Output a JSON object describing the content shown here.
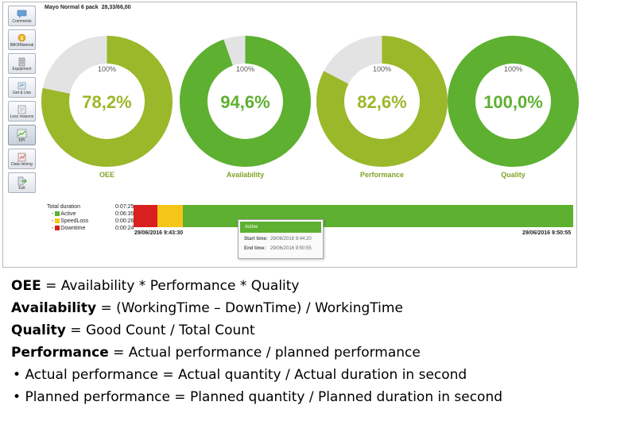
{
  "window": {
    "title": "Mayo Normal 6 pack  28,33/66,00"
  },
  "toolbar": {
    "buttons": [
      {
        "label": "Comments",
        "icon": "comments-icon"
      },
      {
        "label": "BillOfMaterial",
        "icon": "bill-of-material-icon"
      },
      {
        "label": "Equipment",
        "icon": "equipment-icon"
      },
      {
        "label": "Get & Use",
        "icon": "get-and-use-icon"
      },
      {
        "label": "Loss reasons",
        "icon": "loss-reasons-icon"
      },
      {
        "label": "KPI",
        "icon": "kpi-icon",
        "active": true
      },
      {
        "label": "Data mining",
        "icon": "data-mining-icon"
      },
      {
        "label": "Exit",
        "icon": "exit-icon"
      }
    ]
  },
  "kpis": [
    {
      "name": "OEE",
      "value_text": "78,2%",
      "value": 78.2,
      "max_text": "100%",
      "color": "#9ab82a"
    },
    {
      "name": "Availability",
      "value_text": "94,6%",
      "value": 94.6,
      "max_text": "100%",
      "color": "#5eb030"
    },
    {
      "name": "Performance",
      "value_text": "82,6%",
      "value": 82.6,
      "max_text": "100%",
      "color": "#9ab82a"
    },
    {
      "name": "Quality",
      "value_text": "100,0%",
      "value": 100.0,
      "max_text": "100%",
      "color": "#5eb030"
    }
  ],
  "colors": {
    "remainder": "#e3e3e3",
    "label": "#7fa326",
    "active": "#5eb030",
    "speedloss": "#f5c518",
    "downtime": "#d92020"
  },
  "durations": {
    "total": {
      "label": "Total duration",
      "value": "0:07:25"
    },
    "items": [
      {
        "label": "Active",
        "value": "0:06:35",
        "color": "#5eb030"
      },
      {
        "label": "SpeedLoss",
        "value": "0:00:26",
        "color": "#f5c518"
      },
      {
        "label": "Downtime",
        "value": "0:00:24",
        "color": "#d92020"
      }
    ]
  },
  "timeline": {
    "start": "29/06/2016 9:43:30",
    "end": "29/06/2016 9:50:55",
    "segments": [
      {
        "state": "Downtime",
        "seconds": 24,
        "color": "#d92020"
      },
      {
        "state": "SpeedLoss",
        "seconds": 26,
        "color": "#f5c518"
      },
      {
        "state": "Active",
        "seconds": 395,
        "color": "#5eb030"
      }
    ]
  },
  "tooltip": {
    "title": "Active",
    "start_label": "Start time:",
    "start_value": "29/06/2016 9:44:20",
    "end_label": "End time:",
    "end_value": "29/06/2016 9:50:55"
  },
  "formulas": [
    {
      "term": "OEE",
      "rest": " = Availability * Performance * Quality"
    },
    {
      "term": "Availability",
      "rest": " = (WorkingTime – DownTime) / WorkingTime"
    },
    {
      "term": "Quality",
      "rest": " = Good Count / Total Count"
    },
    {
      "term": "Performance",
      "rest": " = Actual performance / planned performance"
    }
  ],
  "bullets": [
    "Actual performance = Actual quantity / Actual duration in second",
    "Planned performance = Planned quantity / Planned duration in second"
  ]
}
